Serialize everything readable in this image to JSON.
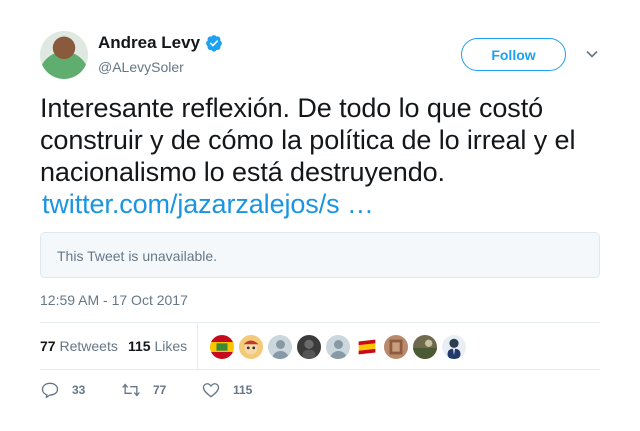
{
  "author": {
    "display_name": "Andrea Levy",
    "handle": "@ALevySoler",
    "verified": true
  },
  "follow_button": {
    "label": "Follow"
  },
  "tweet": {
    "text": "Interesante reflexión. De todo lo que costó construir y de cómo la política de lo irreal y el nacionalismo lo está destruyendo.",
    "link_text": "twitter.com/jazarzalejos/s …",
    "quoted_unavailable": "This Tweet is unavailable.",
    "timestamp": "12:59 AM - 17 Oct 2017"
  },
  "stats": {
    "retweets_count": "77",
    "retweets_label": "Retweets",
    "likes_count": "115",
    "likes_label": "Likes"
  },
  "likers": [
    {
      "icon": "flag-avatar"
    },
    {
      "icon": "cartoon-avatar"
    },
    {
      "icon": "default-avatar"
    },
    {
      "icon": "dark-photo-avatar"
    },
    {
      "icon": "default-avatar"
    },
    {
      "icon": "spain-flag-avatar"
    },
    {
      "icon": "photo-avatar"
    },
    {
      "icon": "landscape-avatar"
    },
    {
      "icon": "person-avatar"
    }
  ],
  "actions": {
    "reply_count": "33",
    "retweet_count": "77",
    "like_count": "115"
  },
  "colors": {
    "accent": "#1da1f2",
    "link": "#1b95e0",
    "muted": "#657786",
    "text": "#14171a",
    "border": "#e6ecf0"
  }
}
